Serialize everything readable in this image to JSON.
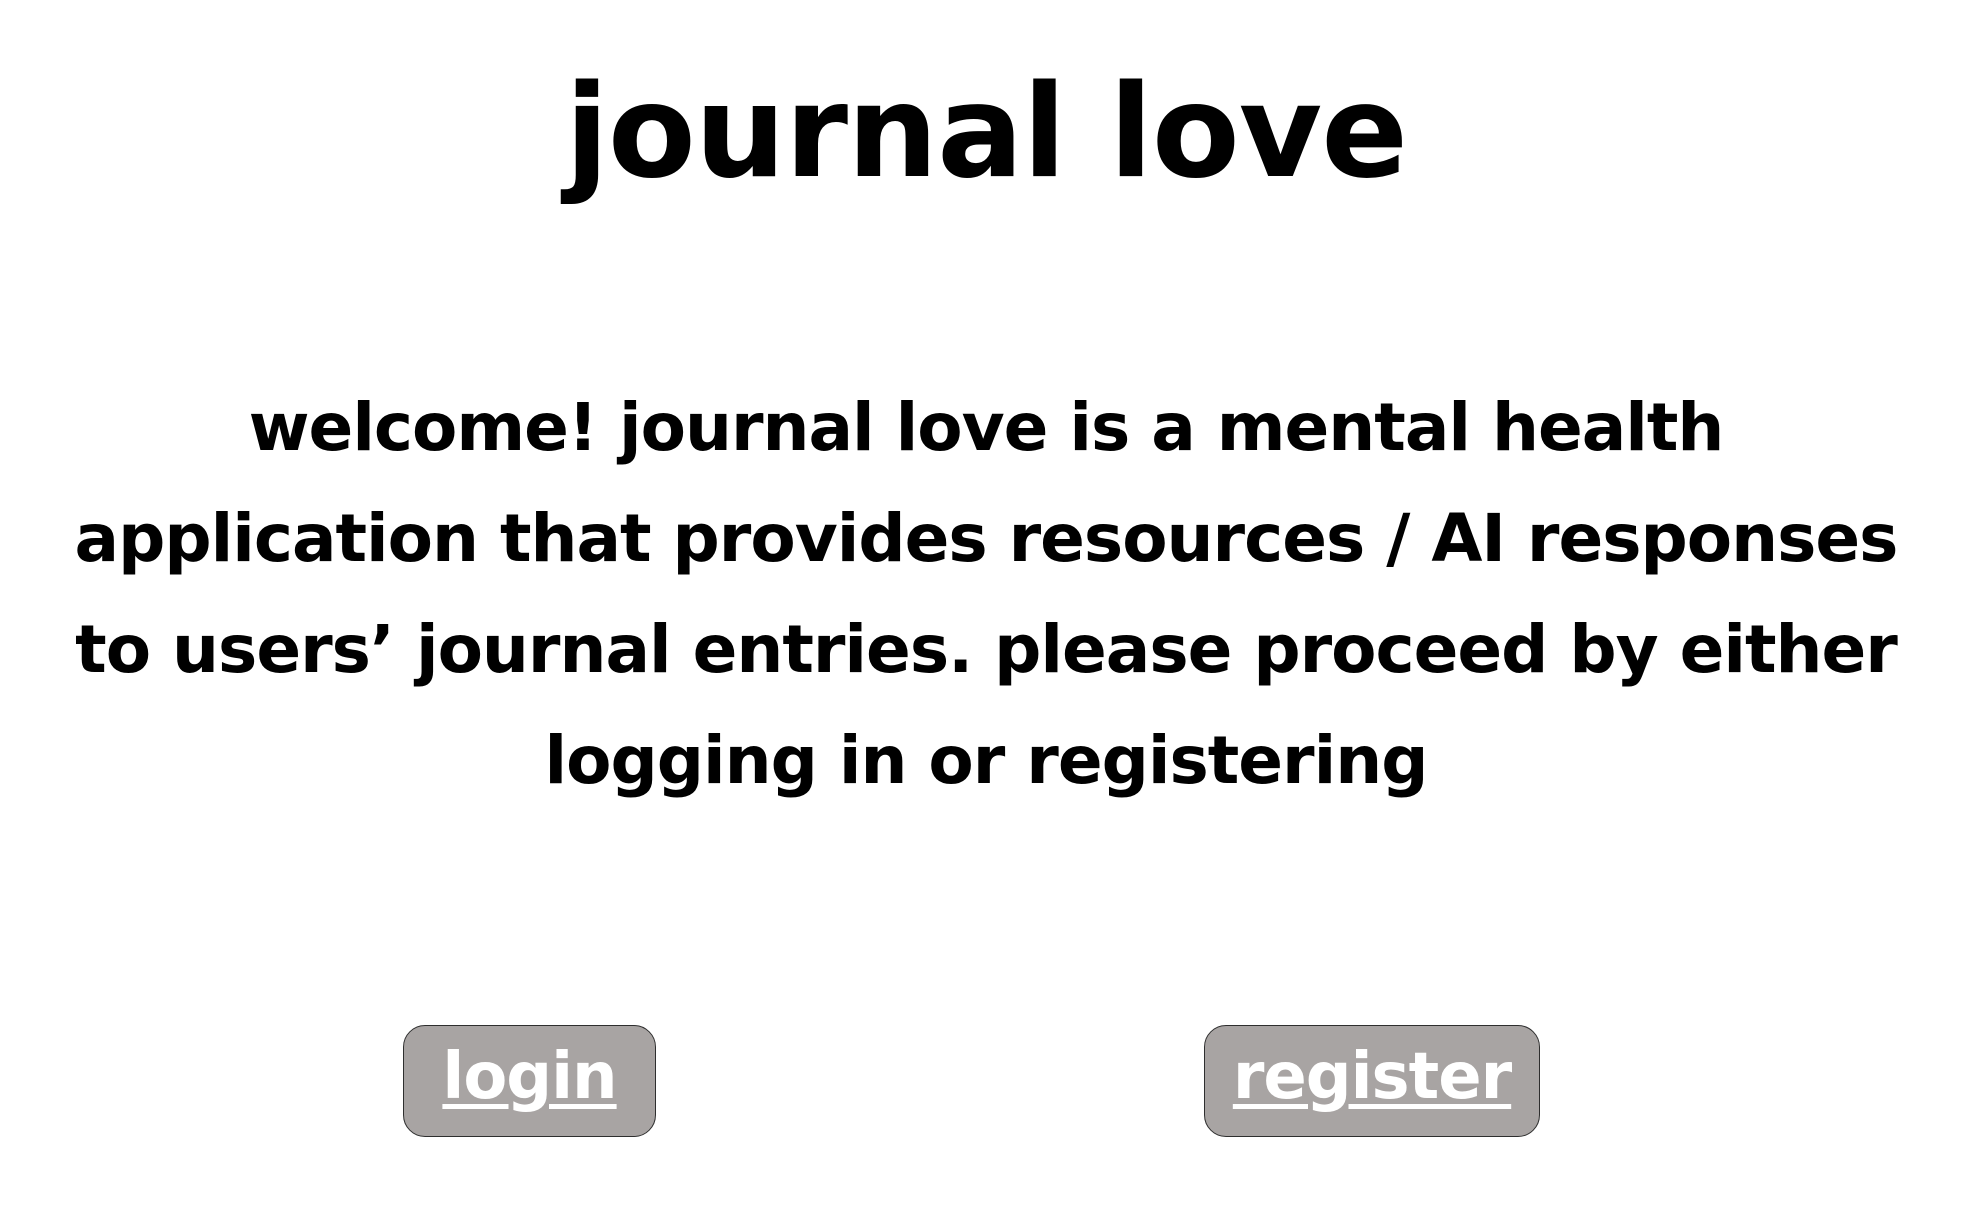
{
  "app": {
    "title": "journal love",
    "intro": "welcome! journal love is a mental health application that provides resources / AI responses to users’ journal entries. please proceed by either logging in or registering"
  },
  "actions": {
    "login_label": "login",
    "register_label": "register"
  },
  "colors": {
    "background": "#ffffff",
    "text": "#000000",
    "button_fill": "#a8a4a3",
    "button_border": "#2e2e2e",
    "button_text": "#ffffff"
  }
}
